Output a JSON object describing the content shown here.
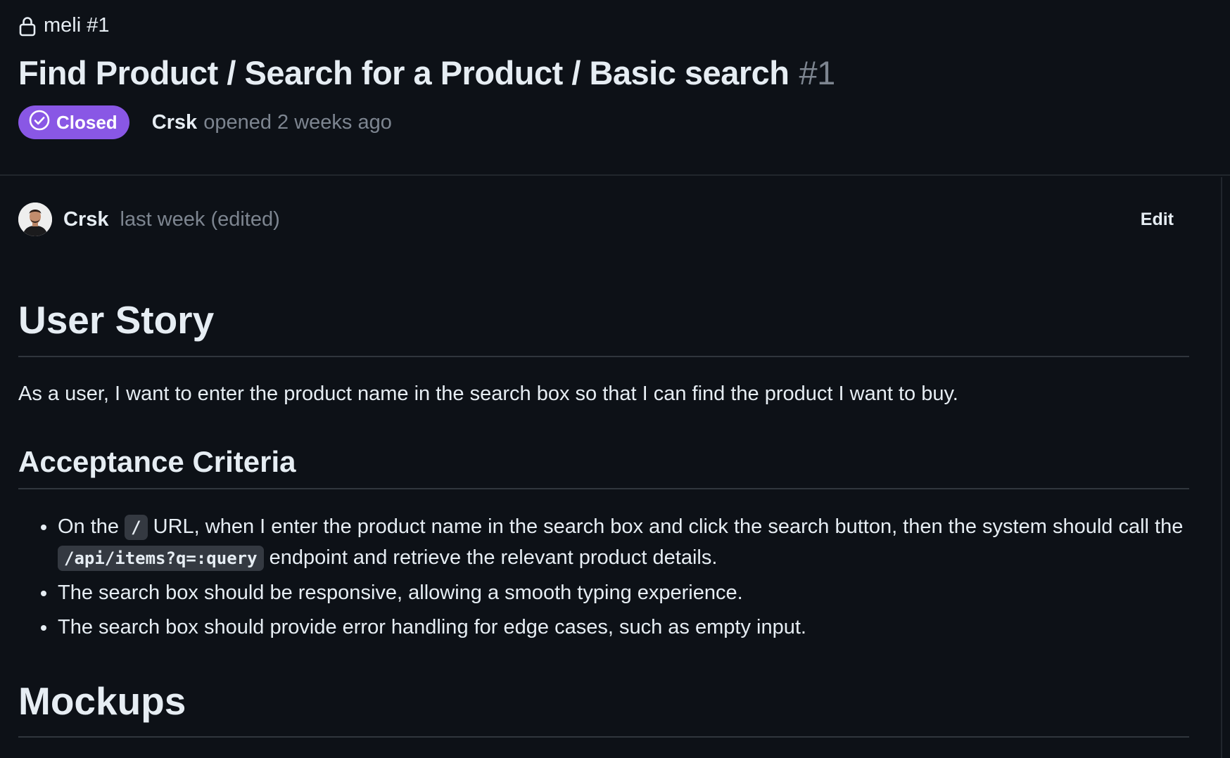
{
  "repo": {
    "icon": "lock-icon",
    "label": "meli #1"
  },
  "issue": {
    "title": "Find Product / Search for a Product / Basic search",
    "number": "#1",
    "state": "Closed",
    "state_color": "#8957e5",
    "author": "Crsk",
    "opened_text": "opened 2 weeks ago"
  },
  "comment": {
    "author": "Crsk",
    "time": "last week (edited)",
    "edit_label": "Edit"
  },
  "body": {
    "user_story_heading": "User Story",
    "user_story_text": "As a user, I want to enter the product name in the search box so that I can find the product I want to buy.",
    "acceptance_heading": "Acceptance Criteria",
    "criteria": [
      {
        "before": "On the ",
        "code1": "/",
        "middle": " URL, when I enter the product name in the search box and click the search button, then the system should call the ",
        "code2": "/api/items?q=:query",
        "after": " endpoint and retrieve the relevant product details."
      },
      {
        "text": "The search box should be responsive, allowing a smooth typing experience."
      },
      {
        "text": "The search box should provide error handling for edge cases, such as empty input."
      }
    ],
    "mockups_heading": "Mockups"
  }
}
